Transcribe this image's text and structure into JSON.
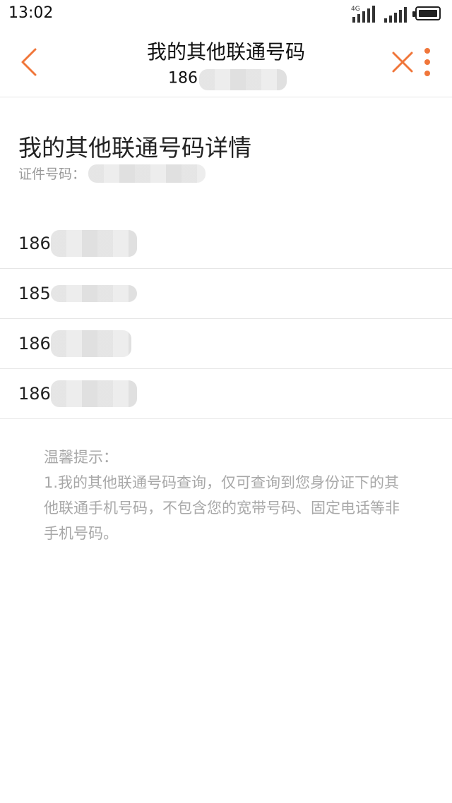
{
  "status_bar": {
    "time": "13:02",
    "network_label": "4G"
  },
  "header": {
    "title": "我的其他联通号码",
    "subtitle_visible_prefix": "186"
  },
  "details": {
    "title": "我的其他联通号码详情",
    "id_label": "证件号码："
  },
  "numbers": [
    {
      "visible_prefix": "186"
    },
    {
      "visible_prefix": "185"
    },
    {
      "visible_prefix": "186"
    },
    {
      "visible_prefix": "186"
    }
  ],
  "tips": {
    "heading": "温馨提示：",
    "body": "1.我的其他联通号码查询，仅可查询到您身份证下的其他联通手机号码，不包含您的宽带号码、固定电话等非手机号码。"
  },
  "colors": {
    "accent": "#f0763a",
    "divider": "#e6e6e6",
    "hint_text": "#a8a8a8"
  }
}
